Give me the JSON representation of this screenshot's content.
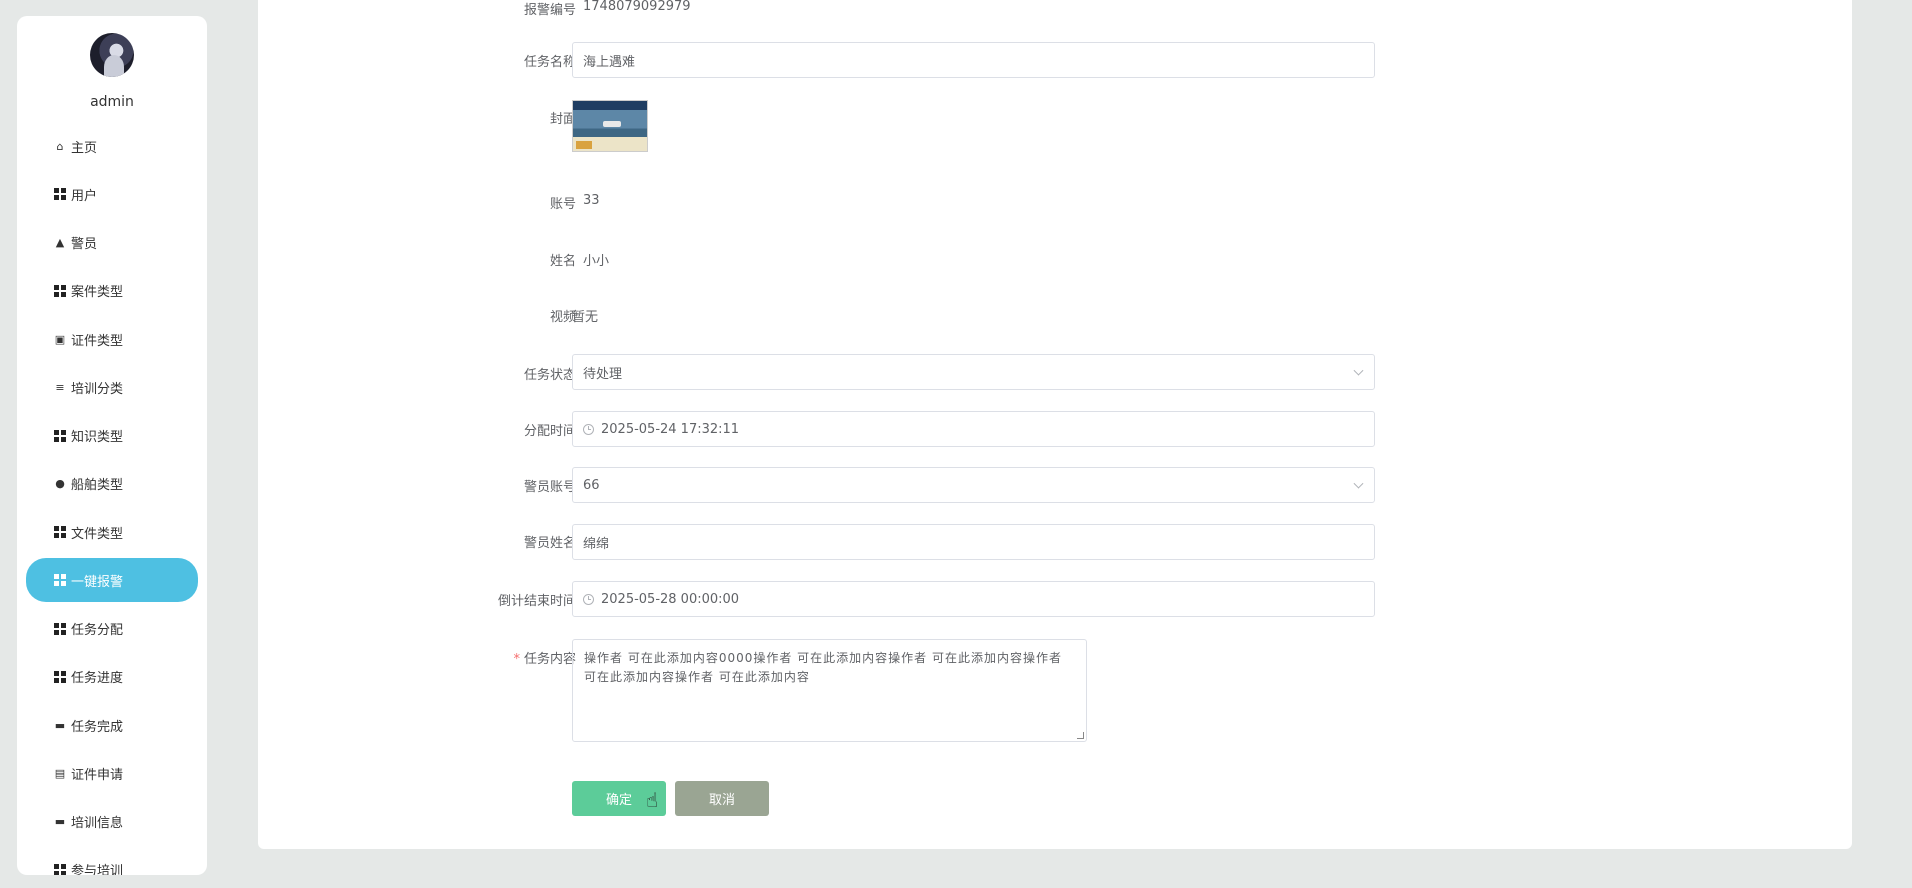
{
  "sidebar": {
    "username": "admin",
    "items": [
      {
        "label": "主页",
        "icon": "home-icon"
      },
      {
        "label": "用户",
        "icon": "grid-icon"
      },
      {
        "label": "警员",
        "icon": "person-icon"
      },
      {
        "label": "案件类型",
        "icon": "grid-icon"
      },
      {
        "label": "证件类型",
        "icon": "briefcase-icon"
      },
      {
        "label": "培训分类",
        "icon": "sliders-icon"
      },
      {
        "label": "知识类型",
        "icon": "grid-icon"
      },
      {
        "label": "船舶类型",
        "icon": "pin-icon"
      },
      {
        "label": "文件类型",
        "icon": "grid-icon"
      },
      {
        "label": "一键报警",
        "icon": "grid-icon",
        "active": true
      },
      {
        "label": "任务分配",
        "icon": "grid-icon"
      },
      {
        "label": "任务进度",
        "icon": "grid-icon"
      },
      {
        "label": "任务完成",
        "icon": "monitor-icon"
      },
      {
        "label": "证件申请",
        "icon": "clipboard-icon"
      },
      {
        "label": "培训信息",
        "icon": "wallet-icon"
      },
      {
        "label": "参与培训",
        "icon": "grid-icon"
      }
    ],
    "accent_color": "#4ec0e2"
  },
  "form": {
    "report_no": {
      "label": "报警编号",
      "value": "1748079092979"
    },
    "task_name": {
      "label": "任务名称",
      "value": "海上遇难"
    },
    "cover": {
      "label": "封面"
    },
    "account": {
      "label": "账号",
      "value": "33"
    },
    "name": {
      "label": "姓名",
      "value": "小小"
    },
    "video": {
      "label": "视频",
      "value": "暂无"
    },
    "task_status": {
      "label": "任务状态",
      "value": "待处理"
    },
    "assign_time": {
      "label": "分配时间",
      "value": "2025-05-24 17:32:11"
    },
    "officer_account": {
      "label": "警员账号",
      "value": "66"
    },
    "officer_name": {
      "label": "警员姓名",
      "value": "绵绵"
    },
    "countdown_end": {
      "label": "倒计结束时间",
      "value": "2025-05-28 00:00:00"
    },
    "task_content": {
      "required_mark": "*",
      "label": "任务内容",
      "value": "操作者 可在此添加内容0000操作者 可在此添加内容操作者 可在此添加内容操作者 可在此添加内容操作者 可在此添加内容"
    }
  },
  "buttons": {
    "confirm": "确定",
    "cancel": "取消",
    "confirm_color": "#5ccc99",
    "cancel_color": "#9aa593"
  }
}
